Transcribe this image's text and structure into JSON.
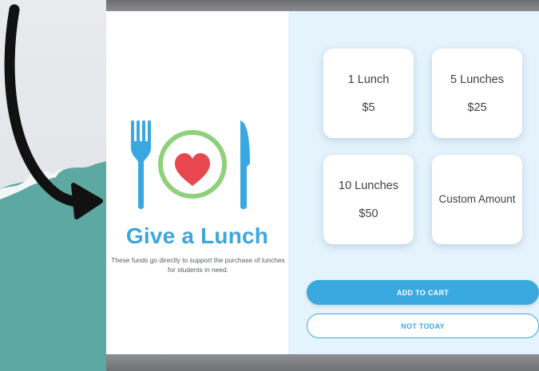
{
  "campaign": {
    "title": "Give a Lunch",
    "description": "These funds go directly to support the purchase of lunches for students in need."
  },
  "options": [
    {
      "name": "1 Lunch",
      "price": "$5"
    },
    {
      "name": "5 Lunches",
      "price": "$25"
    },
    {
      "name": "10 Lunches",
      "price": "$50"
    },
    {
      "name": "Custom Amount"
    }
  ],
  "buttons": {
    "add_to_cart": "ADD TO CART",
    "not_today": "NOT TODAY"
  },
  "icons": {
    "plate": "fork-plate-heart-knife-icon",
    "arrow": "curved-arrow-icon"
  },
  "colors": {
    "accent": "#39a9e0",
    "heart": "#e8474f",
    "plate_ring": "#8fd17a",
    "panel_bg": "#e5f3fc",
    "teal": "#5ea8a2"
  }
}
